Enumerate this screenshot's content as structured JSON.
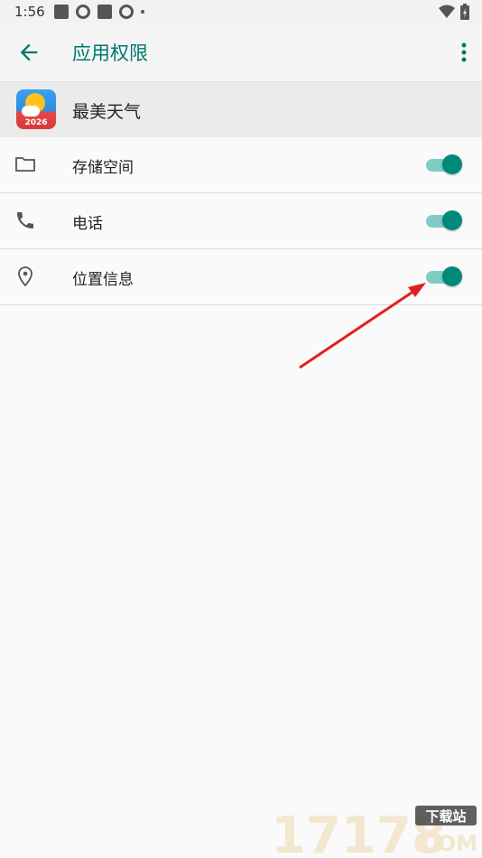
{
  "status_bar": {
    "time": "1:56"
  },
  "toolbar": {
    "title": "应用权限"
  },
  "app": {
    "name": "最美天气",
    "icon_year": "2026"
  },
  "permissions": [
    {
      "label": "存储空间",
      "icon": "folder-icon",
      "enabled": true
    },
    {
      "label": "电话",
      "icon": "phone-icon",
      "enabled": true
    },
    {
      "label": "位置信息",
      "icon": "location-icon",
      "enabled": true
    }
  ],
  "watermark": {
    "number": "17178",
    "tag": "下载站",
    "domain": ".COM"
  },
  "colors": {
    "accent": "#00796b",
    "switch_thumb": "#00897b",
    "switch_track": "#80cbc4",
    "annotation_arrow": "#e02020"
  }
}
